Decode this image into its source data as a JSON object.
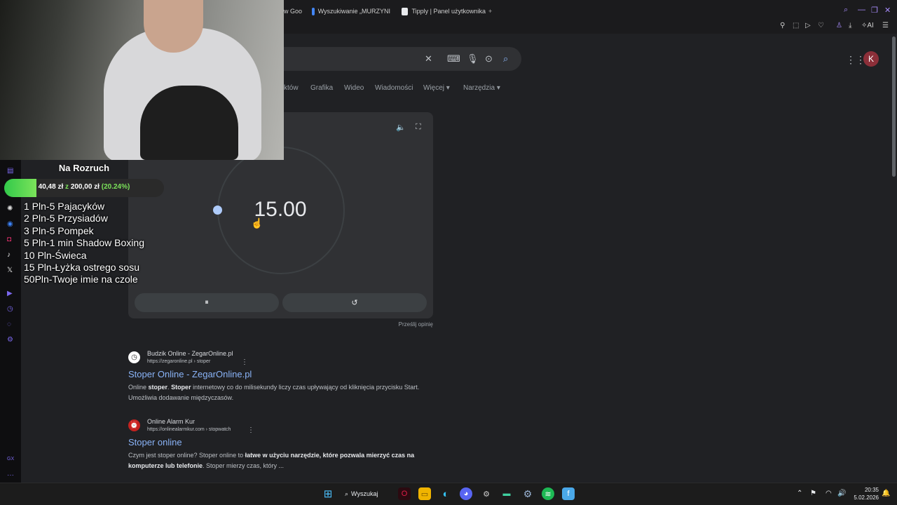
{
  "browser": {
    "tabs": [
      {
        "label": "Wyszukiwanie „MURZYNI",
        "icon": "google-favicon"
      },
      {
        "label": "Tipply | Panel użytkownika",
        "icon": "tipply-favicon"
      }
    ],
    "partial_tab_label": "w Goo",
    "new_tab": "+"
  },
  "search": {
    "query": "",
    "tabs": [
      "któw",
      "Grafika",
      "Wideo",
      "Wiadomości",
      "Więcej",
      "Narzędzia"
    ],
    "avatar_letter": "K"
  },
  "timer": {
    "value": "15.00",
    "pause_label": "⏸",
    "reset_label": "↺",
    "feedback": "Prześlij opinię"
  },
  "results": [
    {
      "site": "Budzik Online - ZegarOnline.pl",
      "url": "https://zegaronline.pl › stoper",
      "title": "Stoper Online - ZegarOnline.pl",
      "snippet_html": "Online <b>stoper</b>. <b>Stoper</b> internetowy co do milisekundy liczy czas upływający od kliknięcia przycisku Start. Umożliwia dodawanie międzyczasów."
    },
    {
      "site": "Online Alarm Kur",
      "url": "https://onlinealarmkur.com › stopwatch",
      "title": "Stoper online",
      "snippet_html": "Czym jest stoper online? Stoper online to <b>łatwe w użyciu narzędzie, które pozwala mierzyć czas na komputerze lub telefonie</b>. Stoper mierzy czas, który ..."
    }
  ],
  "overlay": {
    "title": "Na Rozruch",
    "goal_current": "40,48 zł",
    "goal_sep": "z",
    "goal_target": "200,00 zł",
    "goal_percent": "(20.24%)",
    "goal_fraction": 0.2024,
    "rewards": [
      "1 Pln-5 Pajacyków",
      "2 Pln-5 Przysiadów",
      "3 Pln-5 Pompek",
      "5 Pln-1 min Shadow Boxing",
      "10 Pln-Świeca",
      "15 Pln-Łyżka ostrego sosu",
      "50Pln-Twoje imie na czole"
    ]
  },
  "taskbar": {
    "search_label": "Wyszukaj",
    "time": "20:35",
    "date": "5.02.2026"
  },
  "colors": {
    "accent": "#8ab4f8",
    "goal_fill": "#32c94a",
    "page_bg": "#202124"
  }
}
